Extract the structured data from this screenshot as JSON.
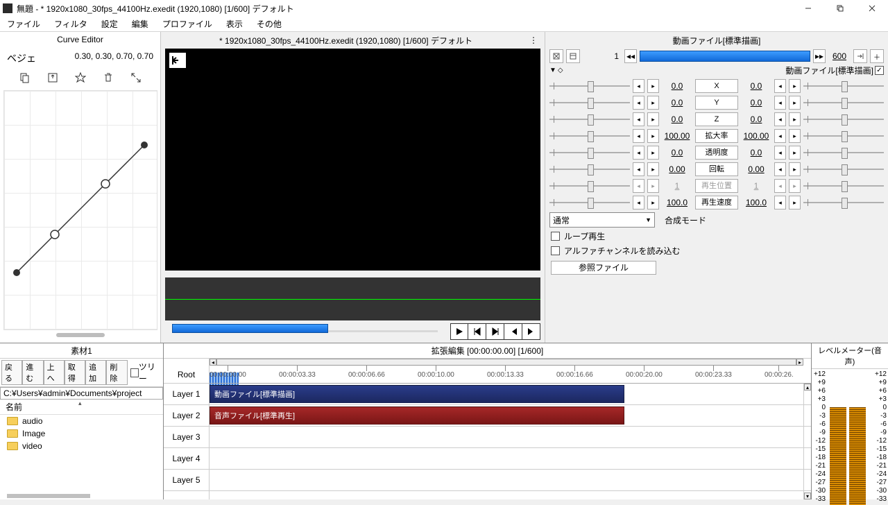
{
  "window": {
    "title": "無題 - * 1920x1080_30fps_44100Hz.exedit (1920,1080)  [1/600]  デフォルト",
    "min": "—",
    "max": "❐",
    "close": "✕"
  },
  "menu": [
    "ファイル",
    "フィルタ",
    "設定",
    "編集",
    "プロファイル",
    "表示",
    "その他"
  ],
  "curve": {
    "title": "Curve Editor",
    "mode": "ベジェ",
    "coords": "0.30, 0.30, 0.70, 0.70"
  },
  "preview": {
    "tab": "* 1920x1080_30fps_44100Hz.exedit (1920,1080)  [1/600]  デフォルト"
  },
  "props": {
    "title": "動画ファイル[標準描画]",
    "frame": "1",
    "total": "600",
    "header_badge": "動画ファイル[標準描画]",
    "rows": [
      {
        "v1": "0.0",
        "label": "X",
        "v2": "0.0"
      },
      {
        "v1": "0.0",
        "label": "Y",
        "v2": "0.0"
      },
      {
        "v1": "0.0",
        "label": "Z",
        "v2": "0.0"
      },
      {
        "v1": "100.00",
        "label": "拡大率",
        "v2": "100.00"
      },
      {
        "v1": "0.0",
        "label": "透明度",
        "v2": "0.0"
      },
      {
        "v1": "0.00",
        "label": "回転",
        "v2": "0.00"
      },
      {
        "v1": "1",
        "label": "再生位置",
        "v2": "1",
        "disabled": true
      },
      {
        "v1": "100.0",
        "label": "再生速度",
        "v2": "100.0"
      }
    ],
    "blend": "通常",
    "blend_label": "合成モード",
    "check1": "ループ再生",
    "check2": "アルファチャンネルを読み込む",
    "ref_btn": "参照ファイル"
  },
  "assets": {
    "title": "素材1",
    "buttons": [
      "戻る",
      "進む",
      "上へ",
      "取得",
      "追加",
      "削除"
    ],
    "tree": "ツリー",
    "path": "C:¥Users¥admin¥Documents¥project",
    "col": "名前",
    "items": [
      "audio",
      "Image",
      "video"
    ]
  },
  "timeline": {
    "title": "拡張編集 [00:00:00.00] [1/600]",
    "root": "Root",
    "layers": [
      "Layer 1",
      "Layer 2",
      "Layer 3",
      "Layer 4",
      "Layer 5"
    ],
    "ticks": [
      "00:00:00.00",
      "00:00:03.33",
      "00:00:06.66",
      "00:00:10.00",
      "00:00:13.33",
      "00:00:16.66",
      "00:00:20.00",
      "00:00:23.33",
      "00:00:26."
    ],
    "clip_video": "動画ファイル[標準描画]",
    "clip_audio": "音声ファイル[標準再生]"
  },
  "meter": {
    "title": "レベルメーター(音声)",
    "scale": [
      "+12",
      "+9",
      "+6",
      "+3",
      "0",
      "-3",
      "-6",
      "-9",
      "-12",
      "-15",
      "-18",
      "-21",
      "-24",
      "-27",
      "-30",
      "-33"
    ]
  }
}
